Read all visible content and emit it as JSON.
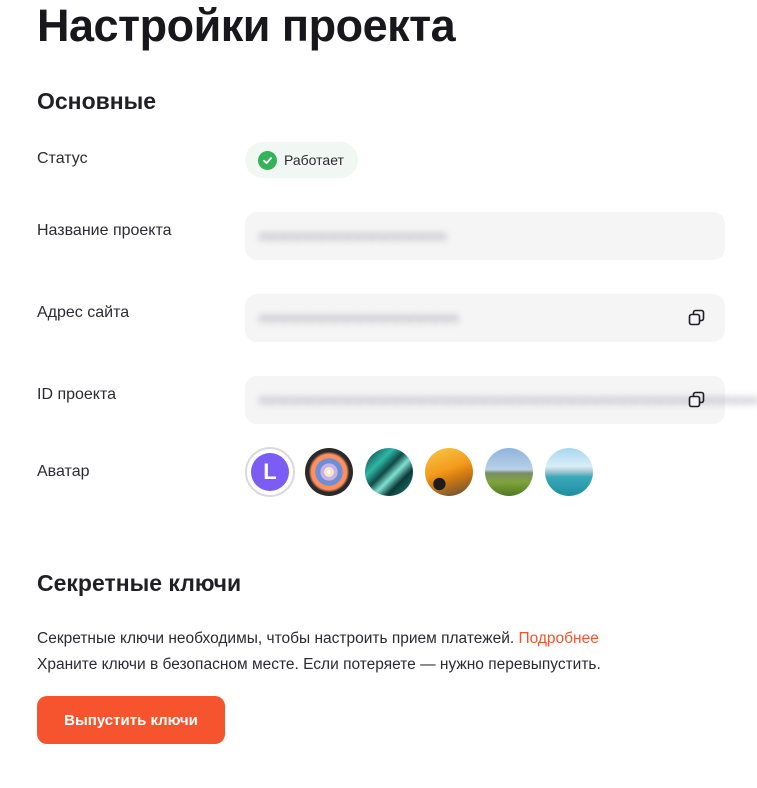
{
  "page": {
    "title": "Настройки проекта"
  },
  "basic": {
    "section_title": "Основные",
    "status": {
      "label": "Статус",
      "value": "Работает",
      "color": "#36b25a"
    },
    "project_name": {
      "label": "Название проекта",
      "value": "mmmmmmmmmmmmmmm"
    },
    "site_address": {
      "label": "Адрес сайта",
      "value": "mmmmmmmmmmmmmmmm"
    },
    "project_id": {
      "label": "ID проекта",
      "value": "mmmmmmmmmmmmmmmmmmmmmmmmmmmmmmmmmmmmmmmm"
    },
    "avatar": {
      "label": "Аватар",
      "letter": "L",
      "options": [
        "letter-l",
        "dandelion",
        "abstract-wave",
        "yellow-car",
        "mont-saint-michel",
        "bay-landscape"
      ]
    }
  },
  "keys": {
    "section_title": "Секретные ключи",
    "description_line1": "Секретные ключи необходимы, чтобы настроить прием платежей.",
    "more_link": "Подробнее",
    "description_line2": "Храните ключи в безопасном месте. Если потеряете — нужно перевыпустить.",
    "issue_button": "Выпустить ключи"
  },
  "colors": {
    "accent": "#f5542f",
    "link": "#f2552c",
    "success": "#36b25a",
    "avatar_letter_bg": "#7b5cf5"
  }
}
